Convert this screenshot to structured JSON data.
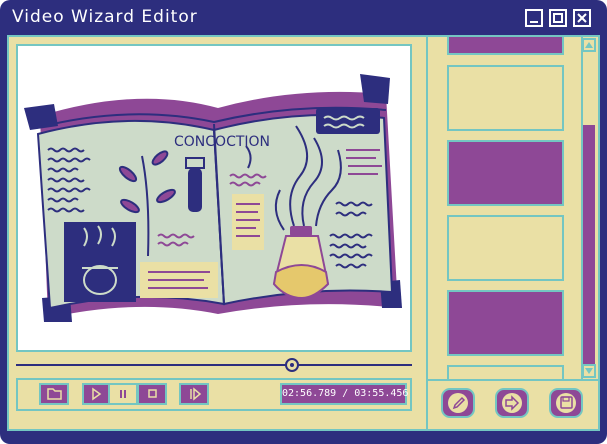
{
  "window": {
    "title": "Video Wizard Editor",
    "controls": [
      "minimize-icon",
      "maximize-icon",
      "close-icon"
    ]
  },
  "player": {
    "content": "illustrated open spell book with potion sketches",
    "book_heading": "CONCOCTION",
    "progress": 0.694,
    "time_display": "02:56.789 / 03:55.456",
    "controls": [
      "open-folder",
      "play",
      "pause",
      "stop",
      "next-frame"
    ]
  },
  "timeline": {
    "thumbnails": [
      "purple",
      "cream",
      "purple",
      "cream",
      "purple",
      "cream"
    ]
  },
  "actions": [
    "edit",
    "forward",
    "save"
  ],
  "colors": {
    "navy": "#2d2e7e",
    "cream": "#eae0a5",
    "teal": "#74c6c2",
    "purple": "#8e4896",
    "sage": "#cddbc9"
  }
}
